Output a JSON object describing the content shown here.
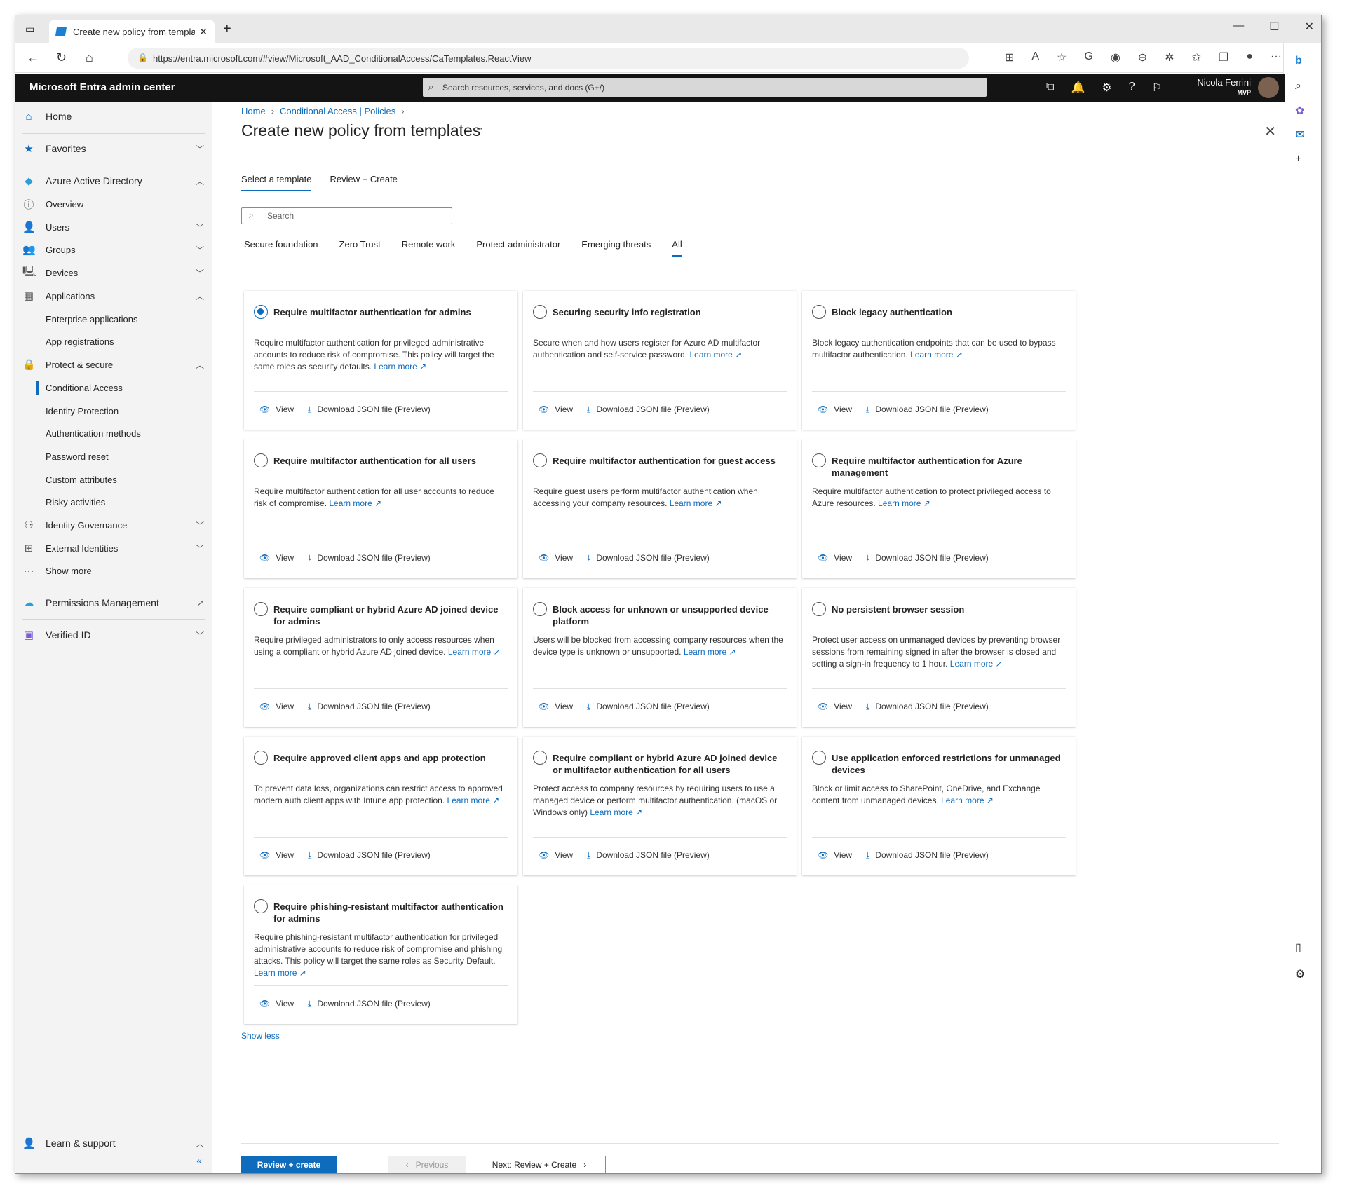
{
  "browser": {
    "tab_title": "Create new policy from template",
    "url": "https://entra.microsoft.com/#view/Microsoft_AAD_ConditionalAccess/CaTemplates.ReactView"
  },
  "portal": {
    "brand": "Microsoft Entra admin center",
    "search_placeholder": "Search resources, services, and docs (G+/)",
    "user_name": "Nicola Ferrini",
    "user_badge": "MVP"
  },
  "nav": {
    "home": "Home",
    "favorites": "Favorites",
    "aad": "Azure Active Directory",
    "overview": "Overview",
    "users": "Users",
    "groups": "Groups",
    "devices": "Devices",
    "applications": "Applications",
    "enterprise_apps": "Enterprise applications",
    "app_regs": "App registrations",
    "protect": "Protect & secure",
    "conditional_access": "Conditional Access",
    "identity_protection": "Identity Protection",
    "auth_methods": "Authentication methods",
    "password_reset": "Password reset",
    "custom_attributes": "Custom attributes",
    "risky_activities": "Risky activities",
    "identity_governance": "Identity Governance",
    "external_identities": "External Identities",
    "show_more": "Show more",
    "permissions_mgmt": "Permissions Management",
    "verified_id": "Verified ID",
    "learn_support": "Learn & support"
  },
  "breadcrumb": {
    "home": "Home",
    "ca": "Conditional Access | Policies"
  },
  "page_title": "Create new policy from templates",
  "tabs": {
    "select": "Select a template",
    "review": "Review + Create"
  },
  "search_placeholder": "Search",
  "filters": [
    "Secure foundation",
    "Zero Trust",
    "Remote work",
    "Protect administrator",
    "Emerging threats",
    "All"
  ],
  "card_actions": {
    "view": "View",
    "download": "Download JSON file (Preview)"
  },
  "learn_more": "Learn more",
  "cards": [
    {
      "title": "Require multifactor authentication for admins",
      "desc": "Require multifactor authentication for privileged administrative accounts to reduce risk of compromise. This policy will target the same roles as security defaults."
    },
    {
      "title": "Securing security info registration",
      "desc": "Secure when and how users register for Azure AD multifactor authentication and self-service password."
    },
    {
      "title": "Block legacy authentication",
      "desc": "Block legacy authentication endpoints that can be used to bypass multifactor authentication."
    },
    {
      "title": "Require multifactor authentication for all users",
      "desc": "Require multifactor authentication for all user accounts to reduce risk of compromise."
    },
    {
      "title": "Require multifactor authentication for guest access",
      "desc": "Require guest users perform multifactor authentication when accessing your company resources."
    },
    {
      "title": "Require multifactor authentication for Azure management",
      "desc": "Require multifactor authentication to protect privileged access to Azure resources."
    },
    {
      "title": "Require compliant or hybrid Azure AD joined device for admins",
      "desc": "Require privileged administrators to only access resources when using a compliant or hybrid Azure AD joined device."
    },
    {
      "title": "Block access for unknown or unsupported device platform",
      "desc": "Users will be blocked from accessing company resources when the device type is unknown or unsupported."
    },
    {
      "title": "No persistent browser session",
      "desc": "Protect user access on unmanaged devices by preventing browser sessions from remaining signed in after the browser is closed and setting a sign-in frequency to 1 hour."
    },
    {
      "title": "Require approved client apps and app protection",
      "desc": "To prevent data loss, organizations can restrict access to approved modern auth client apps with Intune app protection."
    },
    {
      "title": "Require compliant or hybrid Azure AD joined device or multifactor authentication for all users",
      "desc": "Protect access to company resources by requiring users to use a managed device or perform multifactor authentication. (macOS or Windows only)"
    },
    {
      "title": "Use application enforced restrictions for unmanaged devices",
      "desc": "Block or limit access to SharePoint, OneDrive, and Exchange content from unmanaged devices."
    },
    {
      "title": "Require phishing-resistant multifactor authentication for admins",
      "desc": "Require phishing-resistant multifactor authentication for privileged administrative accounts to reduce risk of compromise and phishing attacks. This policy will target the same roles as Security Default."
    }
  ],
  "show_less": "Show less",
  "footer": {
    "review_create": "Review + create",
    "previous": "Previous",
    "next": "Next: Review + Create"
  },
  "colors": {
    "accent": "#0f6cbd",
    "header_bg": "#141414"
  }
}
